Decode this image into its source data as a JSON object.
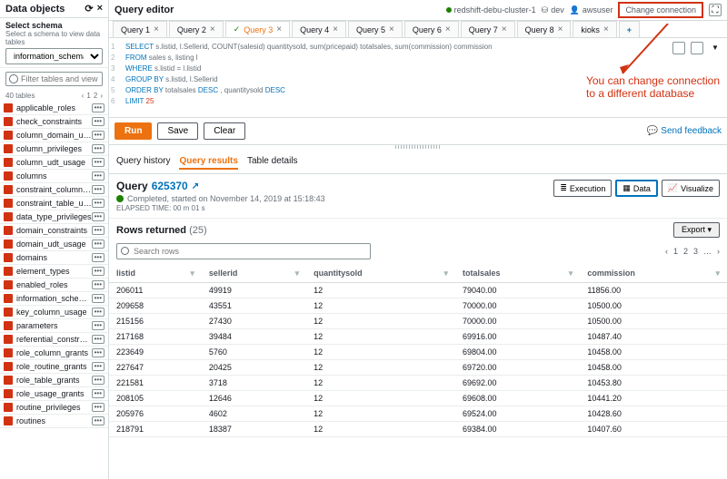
{
  "sidebar": {
    "title": "Data objects",
    "select_schema": "Select schema",
    "help": "Select a schema to view data tables",
    "schema": "information_schema",
    "filter_placeholder": "Filter tables and views",
    "table_count": "40 tables",
    "pager_cur": "1",
    "pager_total": "2",
    "tables": [
      "applicable_roles",
      "check_constraints",
      "column_domain_usage",
      "column_privileges",
      "column_udt_usage",
      "columns",
      "constraint_column_usage",
      "constraint_table_usage",
      "data_type_privileges",
      "domain_constraints",
      "domain_udt_usage",
      "domains",
      "element_types",
      "enabled_roles",
      "information_schema_catalog_...",
      "key_column_usage",
      "parameters",
      "referential_constraints",
      "role_column_grants",
      "role_routine_grants",
      "role_table_grants",
      "role_usage_grants",
      "routine_privileges",
      "routines"
    ]
  },
  "topbar": {
    "title": "Query editor",
    "cluster": "redshift-debu-cluster-1",
    "db": "dev",
    "user": "awsuser",
    "change": "Change connection"
  },
  "tabs": {
    "items": [
      "Query 1",
      "Query 2",
      "Query 3",
      "Query 4",
      "Query 5",
      "Query 6",
      "Query 7",
      "Query 8"
    ],
    "extra": "kioks",
    "active": 2
  },
  "sql": {
    "l1a": "SELECT",
    "l1b": " s.listid, l.Sellerid, COUNT(salesid) quantitysold, sum(pricepaid) totalsales, sum(commission) commission",
    "l2a": "FROM",
    "l2b": " sales s, listing l",
    "l3a": "WHERE",
    "l3b": " s.listid = l.listid",
    "l4a": "GROUP BY",
    "l4b": " s.listid, l.Sellerid",
    "l5a": "ORDER BY",
    "l5b": " totalsales ",
    "l5c": "DESC",
    "l5d": " , quantitysold ",
    "l5e": "DESC",
    "l6a": "LIMIT",
    "l6b": " 25"
  },
  "actions": {
    "run": "Run",
    "save": "Save",
    "clear": "Clear",
    "feedback": "Send feedback"
  },
  "rtabs": {
    "history": "Query history",
    "results": "Query results",
    "details": "Table details"
  },
  "query": {
    "label": "Query",
    "id": "625370",
    "status": "Completed, started on November 14, 2019 at 15:18:43",
    "elapsed": "ELAPSED TIME: 00 m 01 s",
    "btns": {
      "exec": "Execution",
      "data": "Data",
      "viz": "Visualize"
    }
  },
  "rows": {
    "title": "Rows returned",
    "count": "(25)",
    "export": "Export",
    "search_placeholder": "Search rows",
    "pager": {
      "cur": "1",
      "p2": "2",
      "p3": "3",
      "dots": "…"
    },
    "cols": [
      "listid",
      "sellerid",
      "quantitysold",
      "totalsales",
      "commission"
    ],
    "data": [
      [
        "206011",
        "49919",
        "12",
        "79040.00",
        "11856.00"
      ],
      [
        "209658",
        "43551",
        "12",
        "70000.00",
        "10500.00"
      ],
      [
        "215156",
        "27430",
        "12",
        "70000.00",
        "10500.00"
      ],
      [
        "217168",
        "39484",
        "12",
        "69916.00",
        "10487.40"
      ],
      [
        "223649",
        "5760",
        "12",
        "69804.00",
        "10458.00"
      ],
      [
        "227647",
        "20425",
        "12",
        "69720.00",
        "10458.00"
      ],
      [
        "221581",
        "3718",
        "12",
        "69692.00",
        "10453.80"
      ],
      [
        "208105",
        "12646",
        "12",
        "69608.00",
        "10441.20"
      ],
      [
        "205976",
        "4602",
        "12",
        "69524.00",
        "10428.60"
      ],
      [
        "218791",
        "18387",
        "12",
        "69384.00",
        "10407.60"
      ]
    ]
  },
  "annotation": {
    "l1": "You can change connection",
    "l2": "to a different database"
  }
}
